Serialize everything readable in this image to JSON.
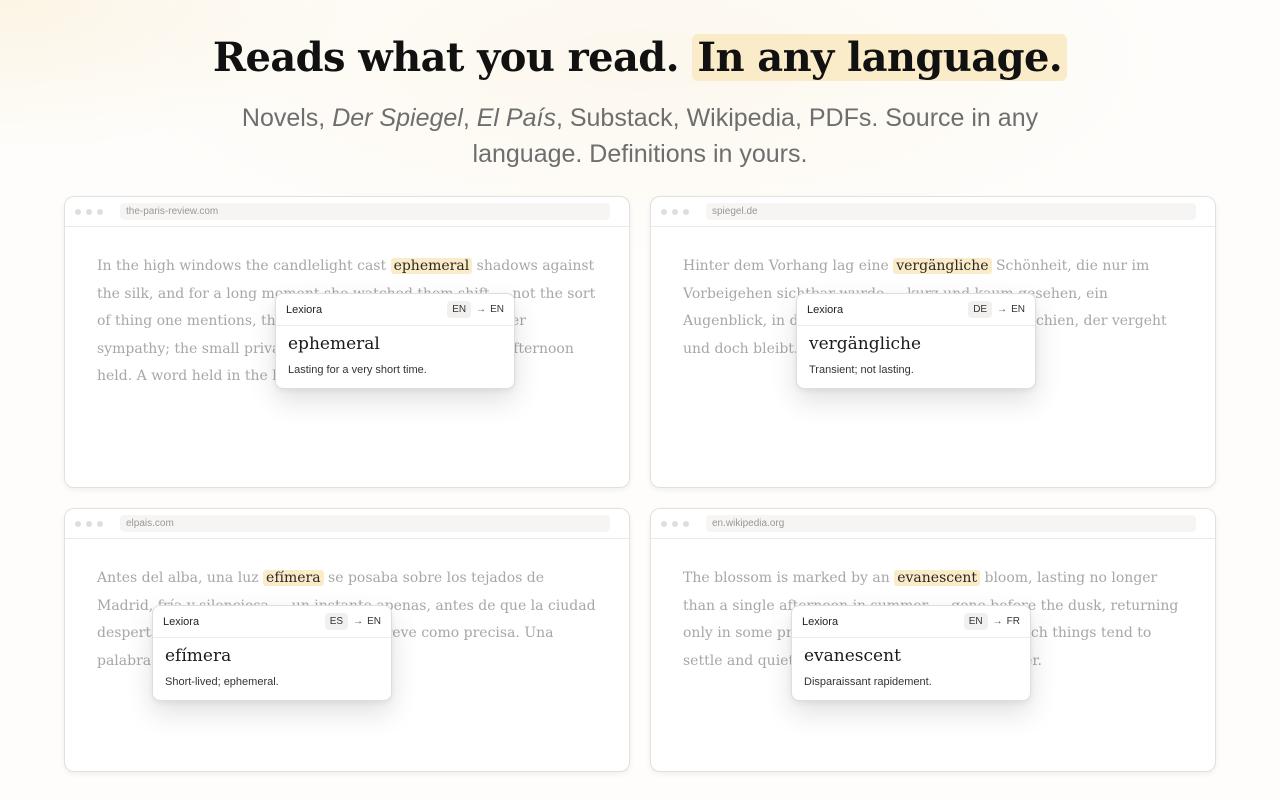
{
  "hero": {
    "headline_plain": "Reads what you read.",
    "headline_highlight": "In any language.",
    "sub": {
      "part1": "Novels, ",
      "italic1": "Der Spiegel",
      "part2": ", ",
      "italic2": "El País",
      "part3": ", Substack, Wikipedia, PDFs. Source in any language. Definitions in yours."
    }
  },
  "cards": [
    {
      "url": "the-paris-review.com",
      "text_before": "In the high windows the candlelight cast ",
      "word": "ephemeral",
      "text_after": " shadows against the silk, and for a long moment she watched them shift — not the sort of thing one mentions, the sort one remembers with a queer sympathy; the small private theatre of the unremarkable afternoon held. A word held in the hand, then released.",
      "popup": {
        "brand": "Lexiora",
        "from": "EN",
        "to": "EN",
        "term": "ephemeral",
        "definition": "Lasting for a very short time."
      }
    },
    {
      "url": "spiegel.de",
      "text_before": "Hinter dem Vorhang lag eine ",
      "word": "vergängliche",
      "text_after": " Schönheit, die nur im Vorbeigehen sichtbar wurde — kurz und kaum gesehen, ein Augenblick, in dem die Stille selbst zu sprechen schien, der vergeht und doch bleibt. Ein Wort, einmal gehört.",
      "popup": {
        "brand": "Lexiora",
        "from": "DE",
        "to": "EN",
        "term": "vergängliche",
        "definition": "Transient; not lasting."
      }
    },
    {
      "url": "elpais.com",
      "text_before": "Antes del alba, una luz ",
      "word": "efímera",
      "text_after": " se posaba sobre los tejados de Madrid, fría y silenciosa — un instante apenas, antes de que la ciudad despertara y la calma se rompiera, tan breve como precisa. Una palabra que se queda.",
      "popup": {
        "brand": "Lexiora",
        "from": "ES",
        "to": "EN",
        "term": "efímera",
        "definition": "Short-lived; ephemeral."
      }
    },
    {
      "url": "en.wikipedia.org",
      "text_before": "The blossom is marked by an ",
      "word": "evanescent",
      "text_after": " bloom, lasting no longer than a single afternoon in summer — gone before the dusk, returning only in some private corner of memory, where such things tend to settle and quietly remain. A flower of fair weather.",
      "popup": {
        "brand": "Lexiora",
        "from": "EN",
        "to": "FR",
        "term": "evanescent",
        "definition": "Disparaissant rapidement."
      }
    }
  ]
}
